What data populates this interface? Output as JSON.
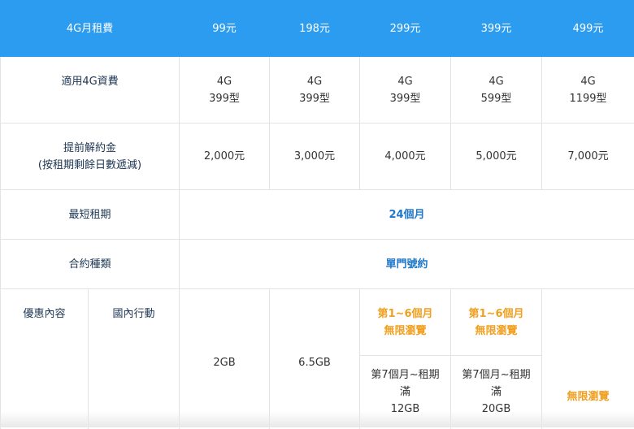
{
  "header": {
    "label": "4G月租費",
    "plans": [
      "99元",
      "198元",
      "299元",
      "399元",
      "499元"
    ]
  },
  "rows": {
    "applicable": {
      "label": "適用4G資費",
      "values": [
        {
          "line1": "4G",
          "line2": "399型"
        },
        {
          "line1": "4G",
          "line2": "399型"
        },
        {
          "line1": "4G",
          "line2": "399型"
        },
        {
          "line1": "4G",
          "line2": "599型"
        },
        {
          "line1": "4G",
          "line2": "1199型"
        }
      ]
    },
    "early_termination": {
      "label_line1": "提前解約金",
      "label_line2": "(按租期剩餘日數遞減)",
      "values": [
        "2,000元",
        "3,000元",
        "4,000元",
        "5,000元",
        "7,000元"
      ]
    },
    "min_term": {
      "label": "最短租期",
      "value": "24個月"
    },
    "contract_type": {
      "label": "合約種類",
      "value": "單門號約"
    },
    "discount": {
      "label": "優惠內容",
      "sub_label": "國內行動",
      "plan1": "2GB",
      "plan2": "6.5GB",
      "plan3_top_line1": "第1~6個月",
      "plan3_top_line2": "無限瀏覽",
      "plan3_bottom_line1": "第7個月~租期",
      "plan3_bottom_line2": "滿",
      "plan3_bottom_line3": "12GB",
      "plan4_top_line1": "第1~6個月",
      "plan4_top_line2": "無限瀏覽",
      "plan4_bottom_line1": "第7個月~租期",
      "plan4_bottom_line2": "滿",
      "plan4_bottom_line3": "20GB",
      "plan5": "無限瀏覽"
    }
  },
  "colors": {
    "header_bg": "#2c9cf0",
    "header_text": "#ffffff",
    "highlight_blue": "#1f77c9",
    "highlight_orange": "#f0a020",
    "label_text": "#1c3552"
  }
}
